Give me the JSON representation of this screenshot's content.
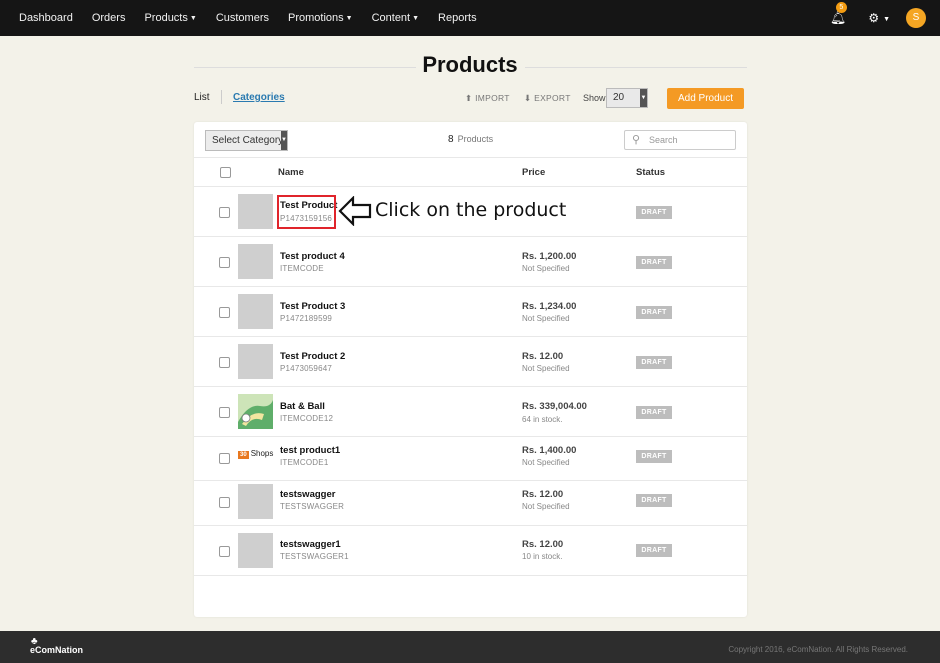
{
  "nav": {
    "items": [
      {
        "label": "Dashboard",
        "dropdown": false
      },
      {
        "label": "Orders",
        "dropdown": false
      },
      {
        "label": "Products",
        "dropdown": true
      },
      {
        "label": "Customers",
        "dropdown": false
      },
      {
        "label": "Promotions",
        "dropdown": true
      },
      {
        "label": "Content",
        "dropdown": true
      },
      {
        "label": "Reports",
        "dropdown": false
      }
    ],
    "notification_count": "5",
    "avatar_initial": "S"
  },
  "page": {
    "title": "Products"
  },
  "subheader": {
    "list_label": "List",
    "categories_label": "Categories",
    "import_label": "IMPORT",
    "export_label": "EXPORT",
    "show_label": "Show",
    "show_value": "20",
    "add_button": "Add Product"
  },
  "filters": {
    "category_select": "Select Category",
    "count": "8",
    "count_label": "Products",
    "search_placeholder": "Search"
  },
  "table": {
    "headers": {
      "name": "Name",
      "price": "Price",
      "status": "Status"
    },
    "rows": [
      {
        "name": "Test Product",
        "code": "P1473159156",
        "price": "",
        "stock": "",
        "status": "DRAFT",
        "thumb": "placeholder"
      },
      {
        "name": "Test product 4",
        "code": "ITEMCODE",
        "price": "Rs. 1,200.00",
        "stock": "Not Specified",
        "status": "DRAFT",
        "thumb": "placeholder"
      },
      {
        "name": "Test Product 3",
        "code": "P1472189599",
        "price": "Rs. 1,234.00",
        "stock": "Not Specified",
        "status": "DRAFT",
        "thumb": "placeholder"
      },
      {
        "name": "Test Product 2",
        "code": "P1473059647",
        "price": "Rs. 12.00",
        "stock": "Not Specified",
        "status": "DRAFT",
        "thumb": "placeholder"
      },
      {
        "name": "Bat & Ball",
        "code": "ITEMCODE12",
        "price": "Rs. 339,004.00",
        "stock": "64 in stock.",
        "status": "DRAFT",
        "thumb": "image"
      },
      {
        "name": "test product1",
        "code": "ITEMCODE1",
        "price": "Rs. 1,400.00",
        "stock": "Not Specified",
        "status": "DRAFT",
        "thumb": "shops-logo"
      },
      {
        "name": "testswagger",
        "code": "TESTSWAGGER",
        "price": "Rs. 12.00",
        "stock": "Not Specified",
        "status": "DRAFT",
        "thumb": "placeholder"
      },
      {
        "name": "testswagger1",
        "code": "TESTSWAGGER1",
        "price": "Rs. 12.00",
        "stock": "10 in stock.",
        "status": "DRAFT",
        "thumb": "placeholder"
      }
    ],
    "shops_logo_text": "Shops",
    "shops_logo_badge": "30"
  },
  "annotation": {
    "text": "Click on the product"
  },
  "footer": {
    "logo": "eComNation",
    "copyright": "Copyright 2016, eComNation. All Rights Reserved."
  },
  "colors": {
    "accent": "#f49a24",
    "nav_bg": "#151515",
    "link": "#2a7ab0",
    "highlight": "#e0242b"
  }
}
